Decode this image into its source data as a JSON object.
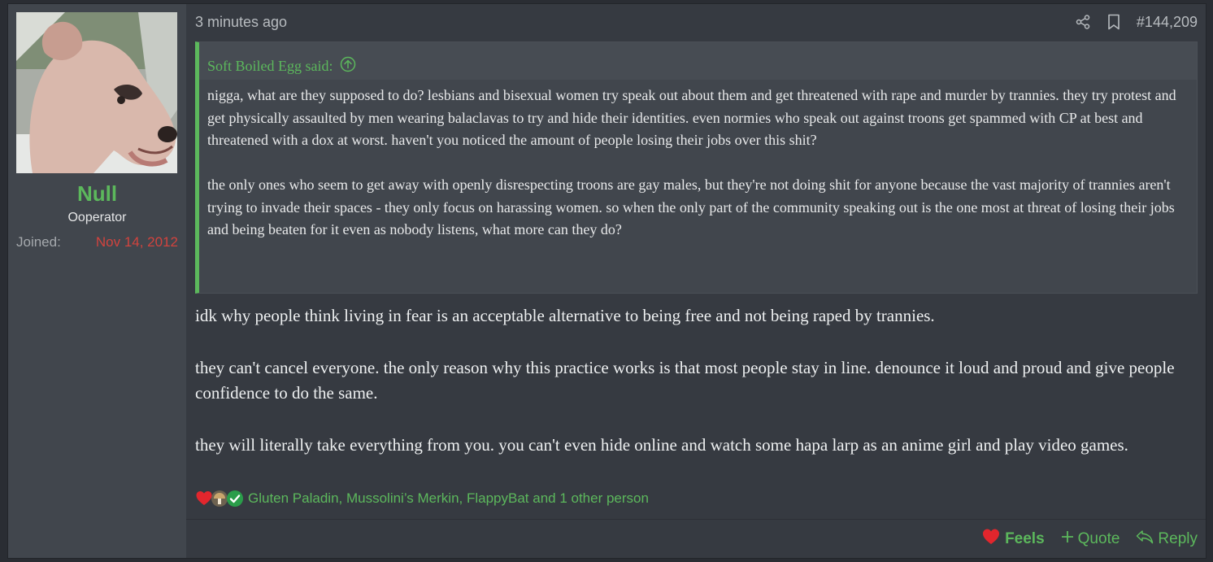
{
  "user": {
    "name": "Null",
    "title": "Ooperator",
    "joined_label": "Joined:",
    "joined_value": "Nov 14, 2012"
  },
  "post": {
    "time": "3 minutes ago",
    "number": "#144,209",
    "icons": [
      "share-icon",
      "bookmark-icon"
    ]
  },
  "quote": {
    "author_line": "Soft Boiled Egg said:",
    "paragraphs": [
      "nigga, what are they supposed to do? lesbians and bisexual women try speak out about them and get threatened with rape and murder by trannies. they try protest and get physically assaulted by men wearing balaclavas to try and hide their identities. even normies who speak out against troons get spammed with CP at best and threatened with a dox at worst. haven't you noticed the amount of people losing their jobs over this shit?",
      "the only ones who seem to get away with openly disrespecting troons are gay males, but they're not doing shit for anyone because the vast majority of trannies aren't trying to invade their spaces - they only focus on harassing women. so when the only part of the community speaking out is the one most at threat of losing their jobs and being beaten for it even as nobody listens, what more can they do?"
    ]
  },
  "message": {
    "paragraphs": [
      "idk why people think living in fear is an acceptable alternative to being free and not being raped by trannies.",
      "they can't cancel everyone. the only reason why this practice works is that most people stay in line. denounce it loud and proud and give people confidence to do the same.",
      "they will literally take everything from you. you can't even hide online and watch some hapa larp as an anime girl and play video games."
    ]
  },
  "reactions": {
    "names": "Gluten Paladin, Mussolini’s Merkin, FlappyBat and 1 other person",
    "icons": [
      "heart-reaction-icon",
      "mushroom-reaction-icon",
      "check-reaction-icon"
    ]
  },
  "footer": {
    "feels_label": "Feels",
    "quote_label": "Quote",
    "reply_label": "Reply"
  },
  "colors": {
    "accent": "#5cb85c",
    "joined_date": "#d2433e",
    "background": "#363a41",
    "sidebar": "#41464d"
  }
}
